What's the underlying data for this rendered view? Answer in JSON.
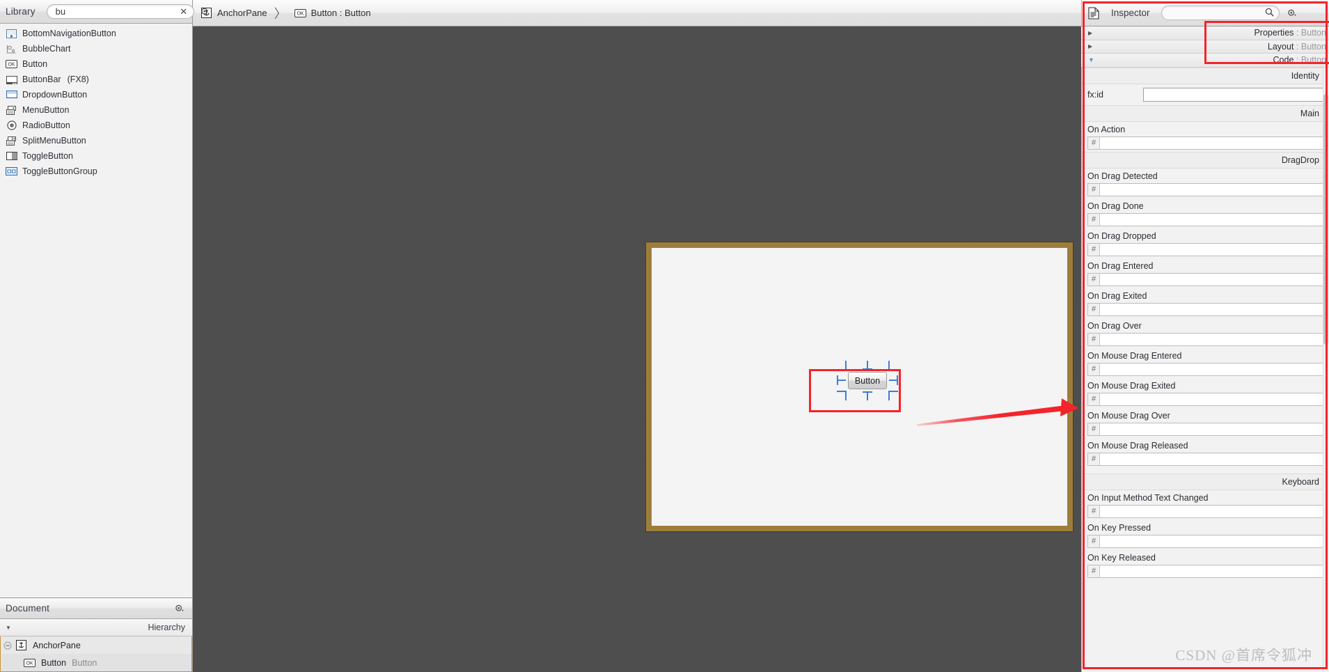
{
  "library": {
    "title": "Library",
    "search_value": "bu",
    "search_placeholder": "",
    "clear_icon": "close-icon",
    "gear_icon": "gear-icon",
    "items": [
      {
        "label": "BottomNavigationButton",
        "sub": "",
        "icon": "bottom-navigation-button-icon"
      },
      {
        "label": "BubbleChart",
        "sub": "",
        "icon": "bubble-chart-icon"
      },
      {
        "label": "Button",
        "sub": "",
        "icon": "button-ok-icon"
      },
      {
        "label": "ButtonBar",
        "sub": "(FX8)",
        "icon": "button-bar-icon"
      },
      {
        "label": "DropdownButton",
        "sub": "",
        "icon": "dropdown-button-icon"
      },
      {
        "label": "MenuButton",
        "sub": "",
        "icon": "menu-button-icon"
      },
      {
        "label": "RadioButton",
        "sub": "",
        "icon": "radio-button-icon"
      },
      {
        "label": "SplitMenuButton",
        "sub": "",
        "icon": "split-menu-button-icon"
      },
      {
        "label": "ToggleButton",
        "sub": "",
        "icon": "toggle-button-icon"
      },
      {
        "label": "ToggleButtonGroup",
        "sub": "",
        "icon": "toggle-button-group-icon"
      }
    ]
  },
  "document": {
    "title": "Document",
    "gear_icon": "gear-icon",
    "hierarchy_label": "Hierarchy",
    "tree": [
      {
        "name": "AnchorPane",
        "extra": "",
        "icon": "anchor-pane-icon",
        "indent": 0,
        "selected": false
      },
      {
        "name": "Button",
        "extra": "Button",
        "icon": "button-ok-icon",
        "indent": 1,
        "selected": true
      }
    ]
  },
  "breadcrumb": {
    "items": [
      {
        "label": "AnchorPane",
        "icon": "anchor-pane-icon"
      },
      {
        "label": "Button : Button",
        "icon": "button-ok-icon"
      }
    ],
    "separator": "〉"
  },
  "canvas": {
    "button_label": "Button",
    "pane_border_color": "#9d7d3b",
    "pane_bg_color": "#f4f4f4",
    "backdrop_color": "#4a4a4a",
    "selection_handle_color": "#3a7fd5",
    "annotation_color": "#f5232a"
  },
  "inspector": {
    "doc_tab_icon": "document-icon",
    "title": "Inspector",
    "search_icon": "search-icon",
    "search_value": "",
    "gear_icon": "gear-icon",
    "accordions": [
      {
        "label": "Properties",
        "object": "Button",
        "expanded": false
      },
      {
        "label": "Layout",
        "object": "Button",
        "expanded": false
      },
      {
        "label": "Code",
        "object": "Button",
        "expanded": true
      }
    ],
    "sections": [
      {
        "band": "Identity",
        "fields": [
          {
            "type": "text",
            "label": "fx:id",
            "value": ""
          }
        ]
      },
      {
        "band": "Main",
        "fields": [
          {
            "type": "event",
            "label": "On Action",
            "prefix": "#",
            "value": ""
          }
        ]
      },
      {
        "band": "DragDrop",
        "fields": [
          {
            "type": "event",
            "label": "On Drag Detected",
            "prefix": "#",
            "value": ""
          },
          {
            "type": "event",
            "label": "On Drag Done",
            "prefix": "#",
            "value": ""
          },
          {
            "type": "event",
            "label": "On Drag Dropped",
            "prefix": "#",
            "value": ""
          },
          {
            "type": "event",
            "label": "On Drag Entered",
            "prefix": "#",
            "value": ""
          },
          {
            "type": "event",
            "label": "On Drag Exited",
            "prefix": "#",
            "value": ""
          },
          {
            "type": "event",
            "label": "On Drag Over",
            "prefix": "#",
            "value": ""
          },
          {
            "type": "event",
            "label": "On Mouse Drag Entered",
            "prefix": "#",
            "value": ""
          },
          {
            "type": "event",
            "label": "On Mouse Drag Exited",
            "prefix": "#",
            "value": ""
          },
          {
            "type": "event",
            "label": "On Mouse Drag Over",
            "prefix": "#",
            "value": ""
          },
          {
            "type": "event",
            "label": "On Mouse Drag Released",
            "prefix": "#",
            "value": ""
          }
        ]
      },
      {
        "band": "Keyboard",
        "fields": [
          {
            "type": "event",
            "label": "On Input Method Text Changed",
            "prefix": "#",
            "value": ""
          },
          {
            "type": "event",
            "label": "On Key Pressed",
            "prefix": "#",
            "value": ""
          },
          {
            "type": "event",
            "label": "On Key Released",
            "prefix": "#",
            "value": ""
          }
        ]
      }
    ]
  },
  "watermark": "CSDN @首席令狐冲"
}
